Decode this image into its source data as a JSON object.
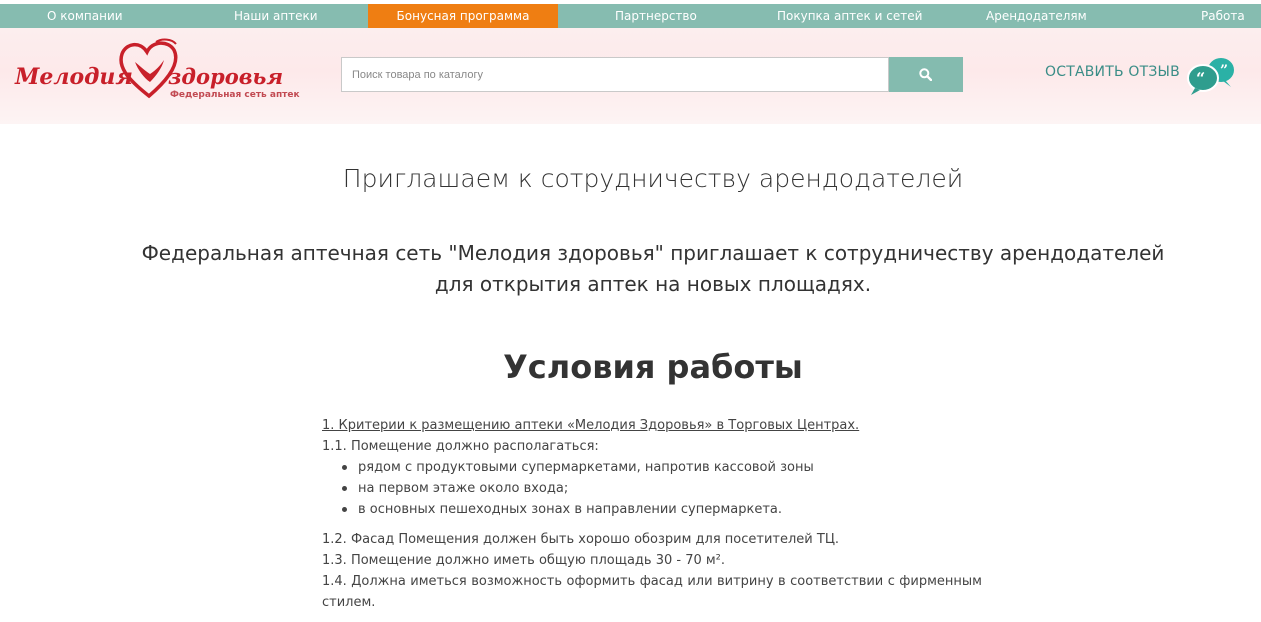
{
  "nav": {
    "items": [
      {
        "label": "О компании"
      },
      {
        "label": "Наши аптеки"
      },
      {
        "label": "Бонусная программа",
        "active": true
      },
      {
        "label": "Партнерство"
      },
      {
        "label": "Покупка аптек и сетей"
      },
      {
        "label": "Арендодателям"
      },
      {
        "label": "Работа"
      }
    ],
    "bg_color": "#86bcb0",
    "active_color": "#ef7e12"
  },
  "header": {
    "logo": {
      "word1": "Мелодия",
      "word2": "здоровья",
      "subtitle": "Федеральная сеть аптек",
      "icon": "heart-logo-icon",
      "color": "#c8202a"
    },
    "search": {
      "placeholder": "Поиск товара по каталогу",
      "value": "",
      "button_icon": "search-icon"
    },
    "feedback": {
      "label": "ОСТАВИТЬ ОТЗЫВ",
      "icon": "speech-bubbles-icon"
    }
  },
  "main": {
    "title": "Приглашаем к сотрудничеству арендодателей",
    "intro_line1": "Федеральная аптечная сеть \"Мелодия здоровья\" приглашает к сотрудничеству арендодателей",
    "intro_line2": "для открытия аптек на новых площадях.",
    "section_title": "Условия работы",
    "criteria_heading": "1. Критерии к размещению аптеки «Мелодия Здоровья» в Торговых Центрах.",
    "p1_1": "1.1. Помещение должно располагаться:",
    "bullets": [
      "рядом с продуктовыми супермаркетами, напротив кассовой зоны",
      "на первом этаже около входа;",
      "в основных пешеходных зонах в направлении супермаркета."
    ],
    "p1_2": "1.2. Фасад Помещения должен быть хорошо обозрим для посетителей ТЦ.",
    "p1_3": "1.3. Помещение должно иметь общую площадь 30 - 70 м².",
    "p1_4": "1.4. Должна иметься возможность оформить фасад или витрину в соответствии с фирменным стилем."
  }
}
